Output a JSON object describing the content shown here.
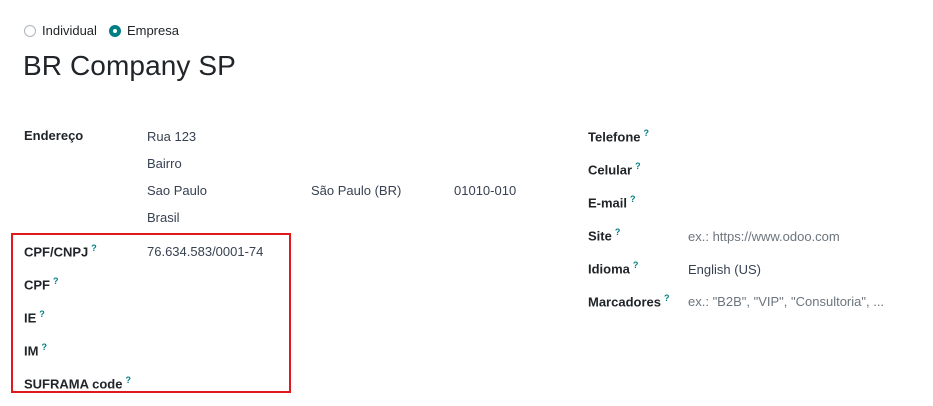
{
  "company_type": {
    "individual_label": "Individual",
    "company_label": "Empresa",
    "selected": "Empresa"
  },
  "company_name": "BR Company SP",
  "address": {
    "label": "Endereço",
    "street": "Rua 123",
    "neighborhood": "Bairro",
    "city": "Sao Paulo",
    "state": "São Paulo (BR)",
    "zip": "01010-010",
    "country": "Brasil"
  },
  "fiscal": {
    "cnpj_label": "CPF/CNPJ",
    "cnpj_value": "76.634.583/0001-74",
    "cpf_label": "CPF",
    "ie_label": "IE",
    "im_label": "IM",
    "suframa_label": "SUFRAMA code"
  },
  "contact": {
    "phone_label": "Telefone",
    "mobile_label": "Celular",
    "email_label": "E-mail",
    "site_label": "Site",
    "site_placeholder": "ex.: https://www.odoo.com",
    "language_label": "Idioma",
    "language_value": "English (US)",
    "tags_label": "Marcadores",
    "tags_placeholder": "ex.: \"B2B\", \"VIP\", \"Consultoria\", ..."
  },
  "help_marker": "?",
  "colors": {
    "accent": "#017e84",
    "highlight_border": "#e0191e"
  }
}
